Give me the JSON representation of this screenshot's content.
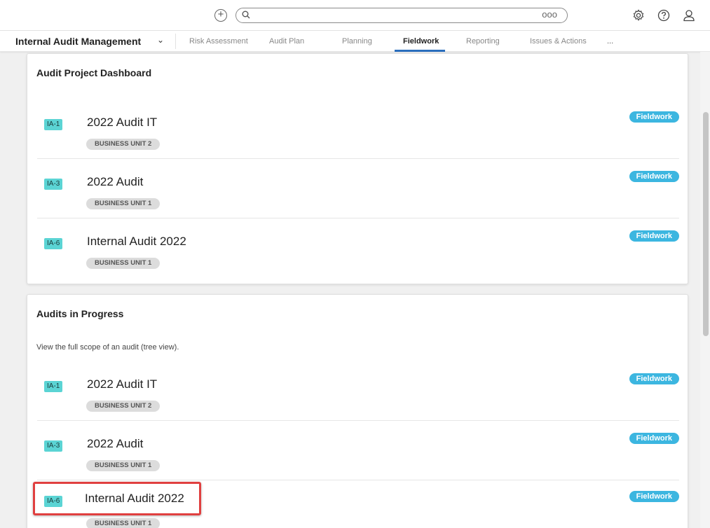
{
  "topbar": {
    "add_icon": "plus-circle-icon",
    "search_icon": "search-icon",
    "search_more": "ooo",
    "icons": [
      "gear-icon",
      "help-icon",
      "user-icon"
    ]
  },
  "nav": {
    "app_name": "Internal Audit Management",
    "chevron": "⌄",
    "tabs": [
      {
        "label": "Risk Assessment",
        "active": false
      },
      {
        "label": "Audit Plan",
        "active": false
      },
      {
        "label": "Planning",
        "active": false
      },
      {
        "label": "Fieldwork",
        "active": true
      },
      {
        "label": "Reporting",
        "active": false
      },
      {
        "label": "Issues & Actions",
        "active": false
      }
    ],
    "more_label": "..."
  },
  "dashboard": {
    "title": "Audit Project Dashboard",
    "rows": [
      {
        "id": "IA-1",
        "title": "2022 Audit IT",
        "unit": "BUSINESS UNIT 2",
        "status": "Fieldwork"
      },
      {
        "id": "IA-3",
        "title": "2022 Audit",
        "unit": "BUSINESS UNIT 1",
        "status": "Fieldwork"
      },
      {
        "id": "IA-6",
        "title": "Internal Audit 2022",
        "unit": "BUSINESS UNIT 1",
        "status": "Fieldwork"
      }
    ]
  },
  "in_progress": {
    "title": "Audits in Progress",
    "description": "View the full scope of an audit (tree view).",
    "rows": [
      {
        "id": "IA-1",
        "title": "2022 Audit IT",
        "unit": "BUSINESS UNIT 2",
        "status": "Fieldwork"
      },
      {
        "id": "IA-3",
        "title": "2022 Audit",
        "unit": "BUSINESS UNIT 1",
        "status": "Fieldwork"
      },
      {
        "id": "IA-6",
        "title": "Internal Audit 2022",
        "unit": "BUSINESS UNIT 1",
        "status": "Fieldwork"
      }
    ]
  },
  "colors": {
    "id_badge": "#5bd4d4",
    "status_pill": "#3cb6e0",
    "unit_pill": "#dcdcdc",
    "active_tab_underline": "#2a6ebd",
    "highlight_box": "#e04040"
  }
}
